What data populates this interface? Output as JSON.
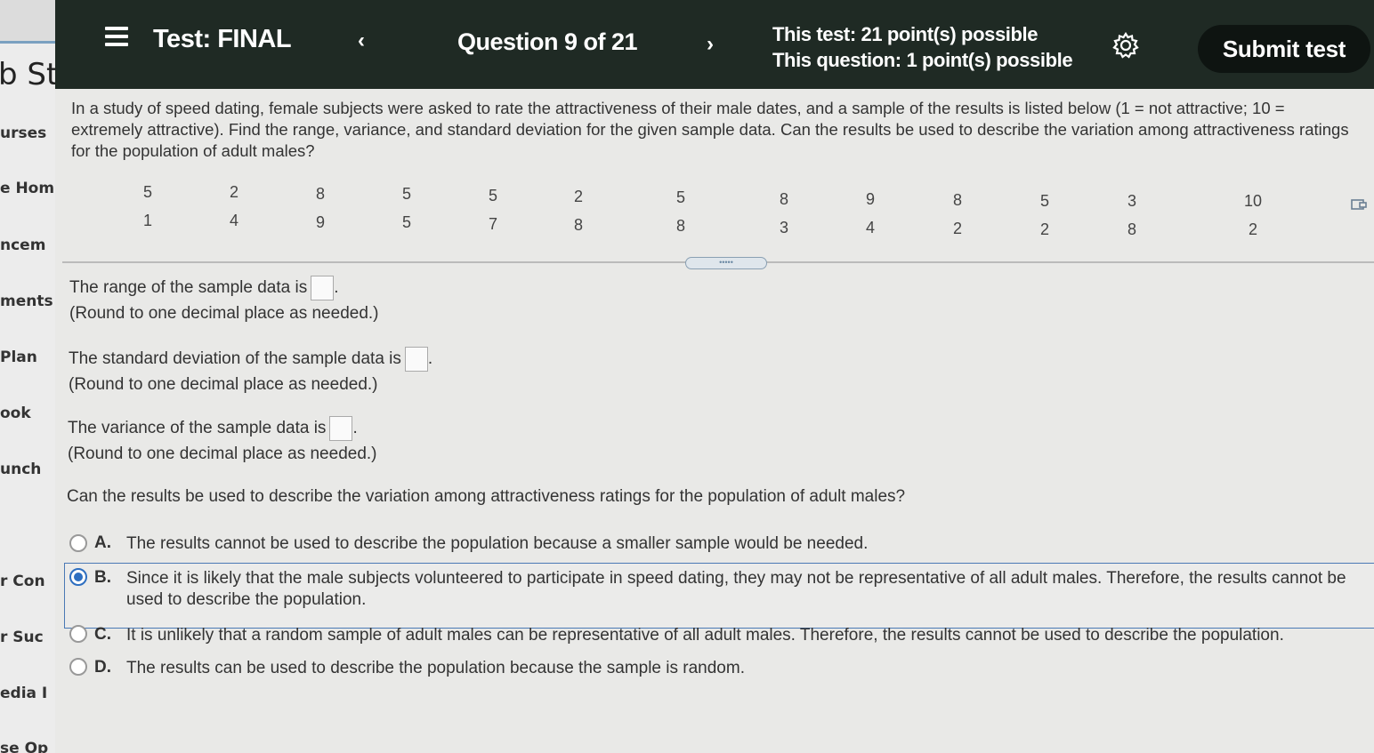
{
  "sidebar": {
    "title": "b St",
    "items": [
      "urses",
      "e Hom",
      "ncem",
      "ments",
      "Plan",
      "ook",
      "unch",
      "r Con",
      "r Suc",
      "edia I",
      "se Op"
    ]
  },
  "header": {
    "title": "Test: FINAL",
    "prev_icon": "‹",
    "counter": "Question 9 of 21",
    "next_icon": "›",
    "points_test": "This test: 21 point(s) possible",
    "points_question": "This question: 1 point(s) possible",
    "submit_label": "Submit test"
  },
  "question": {
    "text": "In a study of speed dating, female subjects were asked to rate the attractiveness of their male dates, and a sample of the results is listed below (1 = not attractive; 10 = extremely attractive). Find the range, variance, and standard deviation for the given sample data. Can the results be used to describe the variation among attractiveness ratings for the population of adult males?"
  },
  "data": {
    "top": [
      "5",
      "2",
      "8",
      "5",
      "5",
      "2",
      "5",
      "8",
      "9",
      "8",
      "5",
      "3",
      "10"
    ],
    "bottom": [
      "1",
      "4",
      "9",
      "5",
      "7",
      "8",
      "8",
      "3",
      "4",
      "2",
      "2",
      "8",
      "2"
    ]
  },
  "handle_dots": "•••••",
  "range": {
    "prompt": "The range of the sample data is",
    "hint": "(Round to one decimal place as needed.)"
  },
  "stdev": {
    "prompt": "The standard deviation of the sample data is",
    "hint": "(Round to one decimal place as needed.)"
  },
  "variance": {
    "prompt": "The variance of the sample data is",
    "hint": "(Round to one decimal place as needed.)"
  },
  "mc": {
    "question": "Can the results be used to describe the variation among attractiveness ratings for the population of adult males?",
    "selected": "B",
    "choices": [
      {
        "letter": "A.",
        "text": "The results cannot be used to describe the population because a smaller sample would be needed."
      },
      {
        "letter": "B.",
        "text": "Since it is likely that the male subjects volunteered to participate in speed dating, they may not be representative of all adult males. Therefore, the results cannot be used to describe the population."
      },
      {
        "letter": "C.",
        "text": "It is unlikely that a random sample of adult males can be representative of all adult males. Therefore, the results cannot be used to describe the population."
      },
      {
        "letter": "D.",
        "text": "The results can be used to describe the population because the sample is random."
      }
    ]
  },
  "colors": {
    "header_bg": "#1f2a24",
    "submit_bg": "#0e1411",
    "accent": "#2d6ec0"
  }
}
